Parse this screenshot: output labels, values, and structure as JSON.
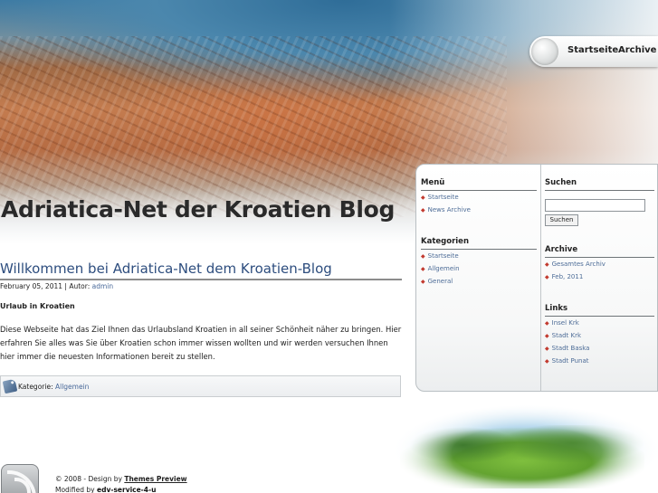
{
  "header": {
    "site_title": "Adriatica-Net der Kroatien Blog",
    "nav": [
      {
        "label": "Startseite"
      },
      {
        "label": "Archive"
      }
    ]
  },
  "post": {
    "title": "Willkommen bei Adriatica-Net dem Kroatien-Blog",
    "date": "February 05, 2011",
    "author_prefix": "| Autor:",
    "author": "admin",
    "subheading": "Urlaub in Kroatien",
    "body": "Diese Webseite hat das Ziel Ihnen das Urlaubsland Kroatien in all seiner Schönheit näher zu bringen. Hier erfahren Sie alles was Sie über Kroatien schon immer wissen wollten und wir werden versuchen Ihnen hier immer die neuesten Informationen bereit zu stellen.",
    "category_label": "Kategorie:",
    "category": "Allgemein"
  },
  "sidebar": {
    "menu": {
      "heading": "Menü",
      "items": [
        "Startseite",
        "News Archive"
      ]
    },
    "categories": {
      "heading": "Kategorien",
      "items": [
        "Startseite",
        "Allgemein",
        "General"
      ]
    },
    "search": {
      "heading": "Suchen",
      "value": "",
      "button": "Suchen"
    },
    "archive": {
      "heading": "Archive",
      "items": [
        "Gesamtes Archiv",
        "Feb, 2011"
      ]
    },
    "links": {
      "heading": "Links",
      "items": [
        "Insel Krk",
        "Stadt Krk",
        "Stadt Baska",
        "Stadt Punat"
      ]
    }
  },
  "footer": {
    "copyright": "© 2008 - Design by",
    "designer": "Themes Preview",
    "modified_prefix": "Modified by",
    "modifier": "edv-service-4-u"
  },
  "colors": {
    "link": "#4d6c97",
    "bullet": "#c23a2f",
    "title": "#2d4d7e"
  }
}
